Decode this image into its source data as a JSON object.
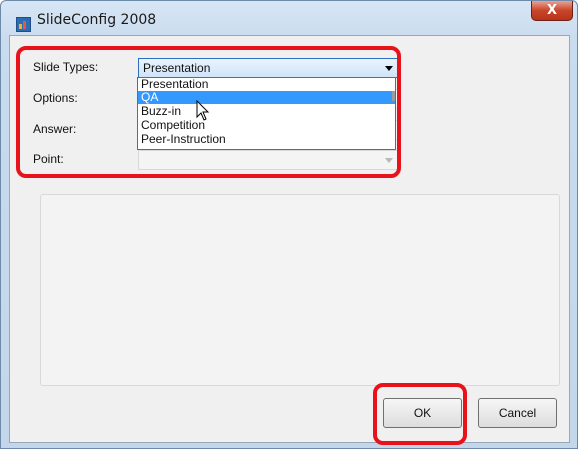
{
  "window": {
    "title": "SlideConfig 2008",
    "close_glyph": "X",
    "icon": "app-icon"
  },
  "form": {
    "slide_types_label": "Slide Types:",
    "options_label": "Options:",
    "answer_label": "Answer:",
    "point_label": "Point:",
    "slide_types_value": "Presentation"
  },
  "dropdown": {
    "options": [
      "Presentation",
      "QA",
      "Buzz-in",
      "Competition",
      "Peer-Instruction"
    ],
    "selected_index": 1
  },
  "buttons": {
    "ok": "OK",
    "cancel": "Cancel"
  },
  "colors": {
    "highlight": "#e8121b",
    "selection": "#3399ff"
  }
}
